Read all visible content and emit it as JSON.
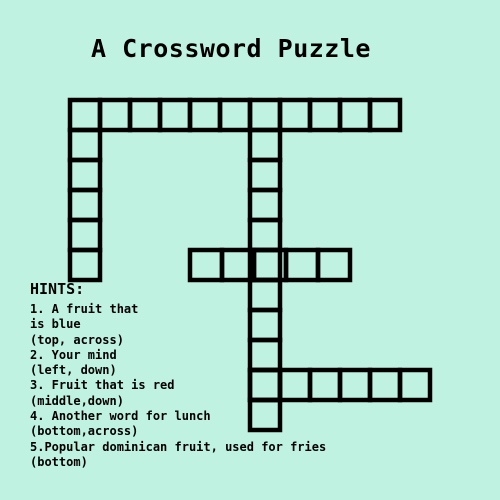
{
  "title": "A Crossword Puzzle",
  "hints": {
    "heading": "HINTS:",
    "lines": [
      "1. A fruit that",
      "is blue",
      "(top, across)",
      "2. Your mind",
      "(left, down)",
      "3. Fruit that is red",
      "(middle,down)",
      "4. Another word for lunch",
      "(bottom,across)",
      "5.Popular dominican fruit, used for fries",
      "(bottom)"
    ]
  },
  "words": [
    {
      "id": "1-across-top",
      "direction": "across",
      "length": 11
    },
    {
      "id": "2-down-left",
      "direction": "down",
      "length": 5
    },
    {
      "id": "3-down-middle",
      "direction": "down",
      "length": 10
    },
    {
      "id": "4-across-bottom",
      "direction": "across",
      "length": 5
    },
    {
      "id": "5-across-middle",
      "direction": "across",
      "length": 5
    }
  ]
}
